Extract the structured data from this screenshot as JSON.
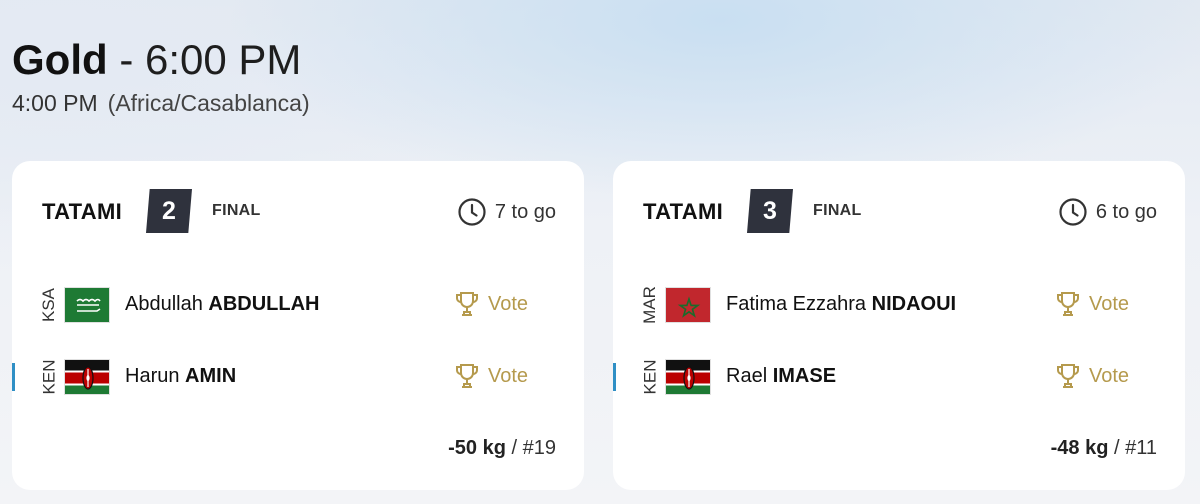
{
  "header": {
    "medal": "Gold",
    "separator": " - ",
    "time": "6:00 PM",
    "local_time": "4:00 PM",
    "timezone": "(Africa/Casablanca)"
  },
  "cards": [
    {
      "tatami_label": "TATAMI",
      "tatami_number": "2",
      "round": "FINAL",
      "to_go": "7 to go",
      "weight": "-50 kg",
      "match_number": "#19",
      "athletes": [
        {
          "country": "KSA",
          "first_name": "Abdullah",
          "last_name": "ABDULLAH",
          "vote_label": "Vote",
          "flag": "saudi-arabia",
          "selected": false
        },
        {
          "country": "KEN",
          "first_name": "Harun",
          "last_name": "AMIN",
          "vote_label": "Vote",
          "flag": "kenya",
          "selected": true
        }
      ]
    },
    {
      "tatami_label": "TATAMI",
      "tatami_number": "3",
      "round": "FINAL",
      "to_go": "6 to go",
      "weight": "-48 kg",
      "match_number": "#11",
      "athletes": [
        {
          "country": "MAR",
          "first_name": "Fatima Ezzahra",
          "last_name": "NIDAOUI",
          "vote_label": "Vote",
          "flag": "morocco",
          "selected": false
        },
        {
          "country": "KEN",
          "first_name": "Rael",
          "last_name": "IMASE",
          "vote_label": "Vote",
          "flag": "kenya",
          "selected": true
        }
      ]
    }
  ],
  "colors": {
    "accent_blue": "#2f8fc5",
    "vote_gold": "#b59a4d",
    "tatami_badge": "#2f323d"
  },
  "separator_slash": " / "
}
